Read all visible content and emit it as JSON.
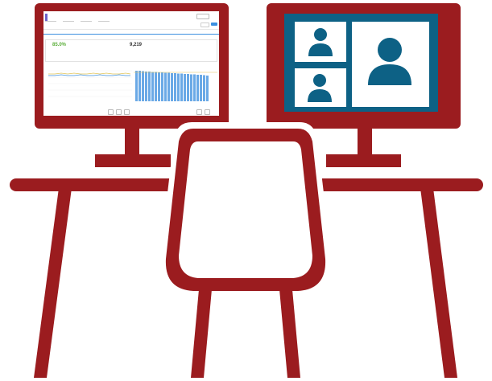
{
  "scene": {
    "colors": {
      "furniture": "#9b1c1f",
      "video_call_frame": "#0d6185",
      "video_call_person": "#0d6185",
      "video_call_tile": "#ffffff",
      "dashboard_accent": "#3b8fe0",
      "dashboard_bar": "#6aa9e6",
      "kpi_green": "#5bae3a"
    },
    "icons": {
      "left_monitor": "monitor-icon",
      "right_monitor": "monitor-icon",
      "desk": "desk-icon",
      "chair": "chair-icon",
      "video_person": "person-icon"
    }
  },
  "dashboard": {
    "kpis": [
      {
        "big": "85.0%"
      },
      {
        "big": "9,219"
      }
    ]
  }
}
